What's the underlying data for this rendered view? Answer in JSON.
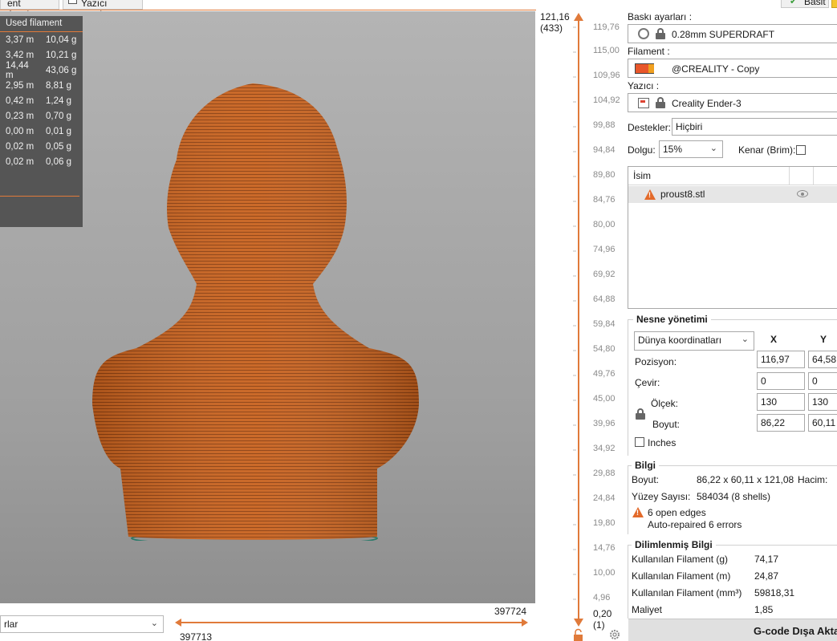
{
  "tabs": {
    "tab_a": "ent Ayarları",
    "tab_b": "Yazıcı ayarları"
  },
  "legend": {
    "header": "Used filament",
    "rows": [
      {
        "m": "3,37 m",
        "g": "10,04 g"
      },
      {
        "m": "3,42 m",
        "g": "10,21 g"
      },
      {
        "m": "14,44 m",
        "g": "43,06 g"
      },
      {
        "m": "2,95 m",
        "g": "8,81 g"
      },
      {
        "m": "0,42 m",
        "g": "1,24 g"
      },
      {
        "m": "0,23 m",
        "g": "0,70 g"
      },
      {
        "m": "0,00 m",
        "g": "0,01 g"
      },
      {
        "m": "0,02 m",
        "g": "0,05 g"
      },
      {
        "m": "0,02 m",
        "g": "0,06 g"
      }
    ]
  },
  "bottom": {
    "view_select": "rlar",
    "h_left": "397713",
    "h_right": "397724"
  },
  "vslider": {
    "top_value": "121,16",
    "top_layer": "(433)",
    "bottom_value": "0,20",
    "bottom_layer": "(1)",
    "ticks": [
      "119,76",
      "115,00",
      "109,96",
      "104,92",
      "99,88",
      "94,84",
      "89,80",
      "84,76",
      "80,00",
      "74,96",
      "69,92",
      "64,88",
      "59,84",
      "54,80",
      "49,76",
      "45,00",
      "39,96",
      "34,92",
      "29,88",
      "24,84",
      "19,80",
      "14,76",
      "10,00",
      "4,96"
    ]
  },
  "panel": {
    "basic_button": "Basit",
    "print_settings_label": "Baskı ayarları :",
    "print_settings_value": "0.28mm SUPERDRAFT",
    "filament_label": "Filament :",
    "filament_value": "@CREALITY - Copy",
    "printer_label": "Yazıcı :",
    "printer_value": "Creality Ender-3",
    "supports_label": "Destekler:",
    "supports_value": "Hiçbiri",
    "infill_label": "Dolgu:",
    "infill_value": "15%",
    "brim_label": "Kenar (Brim):",
    "list_header": "İsim",
    "object_name": "proust8.stl",
    "object_manipulation": {
      "title": "Nesne yönetimi",
      "coord_select": "Dünya koordinatları",
      "x_header": "X",
      "y_header": "Y",
      "position_label": "Pozisyon:",
      "position_x": "116,97",
      "position_y": "64,58",
      "rotate_label": "Çevir:",
      "rotate_x": "0",
      "rotate_y": "0",
      "scale_label": "Ölçek:",
      "scale_x": "130",
      "scale_y": "130",
      "size_label": "Boyut:",
      "size_x": "86,22",
      "size_y": "60,11",
      "inches_label": "Inches"
    },
    "info": {
      "title": "Bilgi",
      "size_label": "Boyut:",
      "size_value": "86,22 x 60,11 x 121,08",
      "volume_label": "Hacim:",
      "facets_label": "Yüzey Sayısı:",
      "facets_value": "584034 (8 shells)",
      "open_edges": "6 open edges",
      "repaired": "Auto-repaired 6 errors"
    },
    "sliced": {
      "title": "Dilimlenmiş Bilgi",
      "rows": [
        {
          "label": "Kullanılan Filament (g)",
          "value": "74,17"
        },
        {
          "label": "Kullanılan Filament (m)",
          "value": "24,87"
        },
        {
          "label": "Kullanılan Filament (mm³)",
          "value": "59818,31"
        },
        {
          "label": "Maliyet",
          "value": "1,85"
        }
      ]
    },
    "export_button": "G-code Dışa Aktar"
  },
  "colors": {
    "accent": "#e07a3a",
    "model": "#c8621e",
    "legend_bg": "#555555"
  }
}
